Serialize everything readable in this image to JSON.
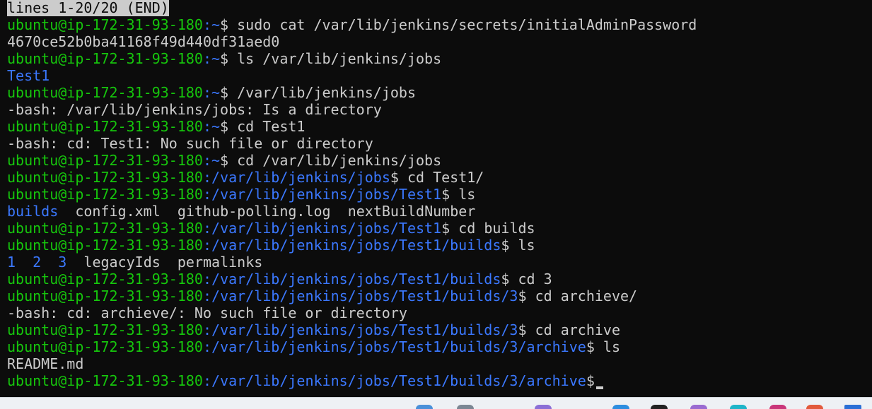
{
  "terminal": {
    "pager_status": "lines 1-20/20 (END)",
    "user_host": "ubuntu@ip-172-31-93-180",
    "lines": [
      {
        "type": "prompt",
        "path": ":~",
        "command": " sudo cat /var/lib/jenkins/secrets/initialAdminPassword"
      },
      {
        "type": "output",
        "text": "4670ce52b0ba41168f49d440df31aed0"
      },
      {
        "type": "prompt",
        "path": ":~",
        "command": " ls /var/lib/jenkins/jobs"
      },
      {
        "type": "dirlist",
        "entries": [
          {
            "name": "Test1",
            "kind": "dir"
          }
        ]
      },
      {
        "type": "prompt",
        "path": ":~",
        "command": " /var/lib/jenkins/jobs"
      },
      {
        "type": "output",
        "text": "-bash: /var/lib/jenkins/jobs: Is a directory"
      },
      {
        "type": "prompt",
        "path": ":~",
        "command": " cd Test1"
      },
      {
        "type": "output",
        "text": "-bash: cd: Test1: No such file or directory"
      },
      {
        "type": "prompt",
        "path": ":~",
        "command": " cd /var/lib/jenkins/jobs"
      },
      {
        "type": "prompt",
        "path": ":/var/lib/jenkins/jobs",
        "command": " cd Test1/"
      },
      {
        "type": "prompt",
        "path": ":/var/lib/jenkins/jobs/Test1",
        "command": " ls"
      },
      {
        "type": "dirlist",
        "entries": [
          {
            "name": "builds",
            "kind": "dir"
          },
          {
            "name": "config.xml",
            "kind": "file"
          },
          {
            "name": "github-polling.log",
            "kind": "file"
          },
          {
            "name": "nextBuildNumber",
            "kind": "file"
          }
        ]
      },
      {
        "type": "prompt",
        "path": ":/var/lib/jenkins/jobs/Test1",
        "command": " cd builds"
      },
      {
        "type": "prompt",
        "path": ":/var/lib/jenkins/jobs/Test1/builds",
        "command": " ls"
      },
      {
        "type": "dirlist",
        "entries": [
          {
            "name": "1",
            "kind": "dir"
          },
          {
            "name": "2",
            "kind": "dir"
          },
          {
            "name": "3",
            "kind": "dir"
          },
          {
            "name": "legacyIds",
            "kind": "file"
          },
          {
            "name": "permalinks",
            "kind": "file"
          }
        ]
      },
      {
        "type": "prompt",
        "path": ":/var/lib/jenkins/jobs/Test1/builds",
        "command": " cd 3"
      },
      {
        "type": "prompt",
        "path": ":/var/lib/jenkins/jobs/Test1/builds/3",
        "command": " cd archieve/"
      },
      {
        "type": "output",
        "text": "-bash: cd: archieve/: No such file or directory"
      },
      {
        "type": "prompt",
        "path": ":/var/lib/jenkins/jobs/Test1/builds/3",
        "command": " cd archive"
      },
      {
        "type": "prompt",
        "path": ":/var/lib/jenkins/jobs/Test1/builds/3/archive",
        "command": " ls"
      },
      {
        "type": "output",
        "text": "README.md"
      },
      {
        "type": "prompt",
        "path": ":/var/lib/jenkins/jobs/Test1/builds/3/archive",
        "command": "",
        "cursor": true
      }
    ]
  },
  "colors": {
    "background": "#0c0c0c",
    "foreground": "#cccccc",
    "user": "#16c60c",
    "path": "#3b78ff"
  }
}
